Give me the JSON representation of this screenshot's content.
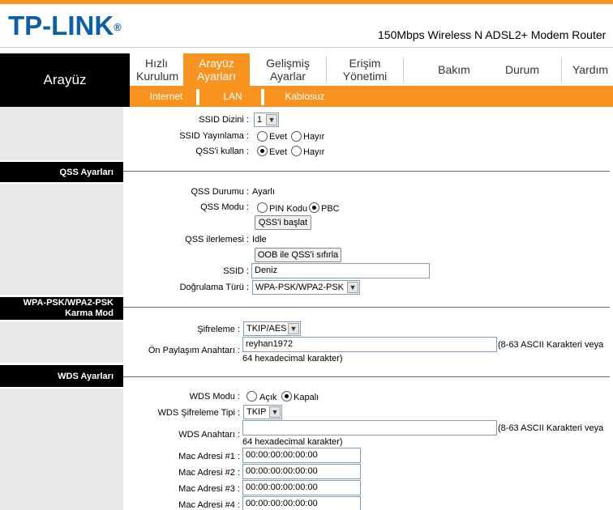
{
  "brand": {
    "logo": "TP-LINK",
    "product": "150Mbps Wireless N ADSL2+ Modem Router"
  },
  "section_label": "Arayüz",
  "main_nav": [
    "Hızlı Kurulum",
    "Arayüz Ayarları",
    "Gelişmiş Ayarlar",
    "Erişim Yönetimi",
    "Bakım",
    "Durum",
    "Yardım"
  ],
  "main_nav_active": "Arayüz Ayarları",
  "sub_nav": [
    "Internet",
    "LAN",
    "Kablosuz"
  ],
  "ssid_section": {
    "ssid_index_label": "SSID Dizini :",
    "ssid_index_value": "1",
    "broadcast_label": "SSID Yayınlama :",
    "broadcast_on": "Evet",
    "broadcast_off": "Hayır",
    "qss_use_label": "QSS'i kullan :",
    "qss_on": "Evet",
    "qss_off": "Hayır"
  },
  "qss_settings": {
    "heading": "QSS Ayarları",
    "status_label": "QSS Durumu :",
    "status_value": "Ayarlı",
    "mode_label": "QSS Modu :",
    "mode_pin": "PIN Kodu",
    "mode_pbc": "PBC",
    "start_button": "QSS'i başlat",
    "progress_label": "QSS ilerlemesi :",
    "progress_value": "Idle",
    "reset_button": "OOB ile QSS'i sıfırla",
    "ssid_label": "SSID :",
    "ssid_value": "Deniz",
    "auth_label": "Doğrulama Türü :",
    "auth_value": "WPA-PSK/WPA2-PSK"
  },
  "wpa_section": {
    "heading_line1": "WPA-PSK/WPA2-PSK",
    "heading_line2": "Karma Mod",
    "encryption_label": "Şifreleme :",
    "encryption_value": "TKIP/AES",
    "psk_label": "Ön Paylaşım Anahtarı :",
    "psk_value": "reyhan1972",
    "psk_hint1": "(8-63 ASCII Karakteri veya",
    "psk_hint2": "64 hexadecimal karakter)"
  },
  "wds_section": {
    "heading": "WDS Ayarları",
    "mode_label": "WDS Modu :",
    "mode_on": "Açık",
    "mode_off": "Kapalı",
    "enc_label": "WDS Şifreleme Tipi :",
    "enc_value": "TKIP",
    "key_label": "WDS Anahtarı :",
    "key_value": "",
    "key_hint1": "(8-63 ASCII Karakteri veya",
    "key_hint2": "64 hexadecimal karakter)",
    "mac1_label": "Mac Adresi #1 :",
    "mac1_value": "00:00:00:00:00:00",
    "mac2_label": "Mac Adresi #2 :",
    "mac2_value": "00:00:00:00:00:00",
    "mac3_label": "Mac Adresi #3 :",
    "mac3_value": "00:00:00:00:00:00",
    "mac4_label": "Mac Adresi #4 :",
    "mac4_value": "00:00:00:00:00:00"
  },
  "colors": {
    "accent": "#f7931e",
    "brand_blue": "#0b5ea8",
    "panel": "#e8e8e8"
  }
}
